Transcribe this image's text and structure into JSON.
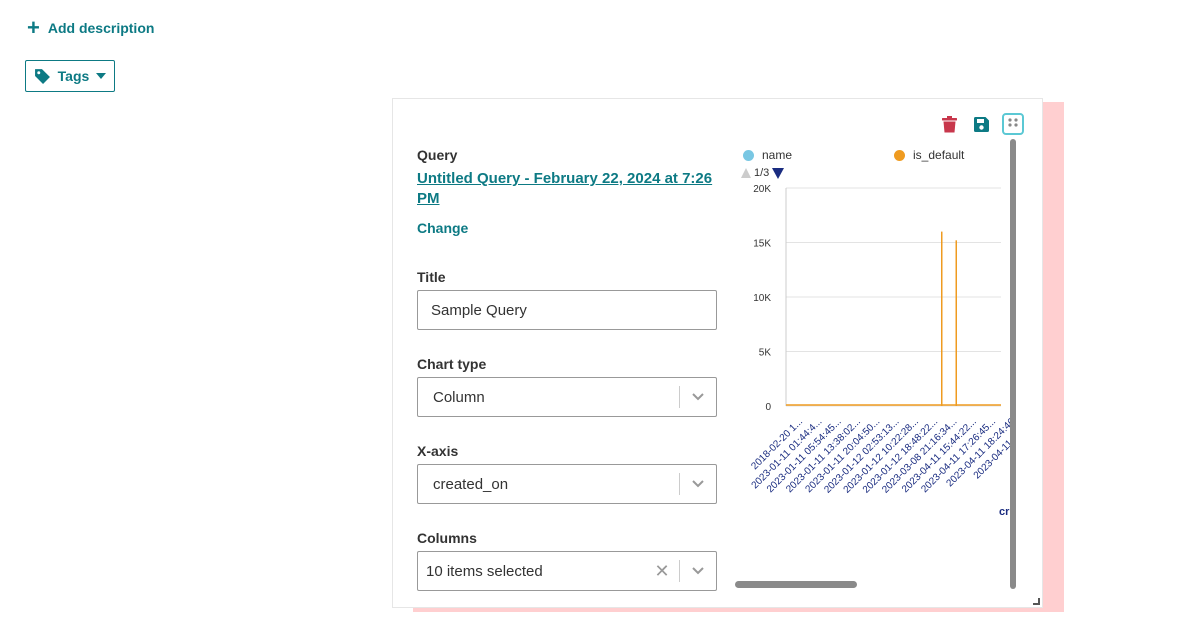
{
  "header": {
    "add_description": "Add description",
    "tags_label": "Tags"
  },
  "card": {
    "query_label": "Query",
    "query_name": "Untitled Query - February 22, 2024 at 7:26 PM",
    "change_label": "Change",
    "title_label": "Title",
    "title_value": "Sample Query",
    "chart_type_label": "Chart type",
    "chart_type_value": "Column",
    "xaxis_label": "X-axis",
    "xaxis_value": "created_on",
    "columns_label": "Columns",
    "columns_value": "10 items selected",
    "colors": {
      "accent": "#0d7a84",
      "delete": "#c8374c",
      "save": "#0d7a84"
    }
  },
  "chart_data": {
    "type": "bar",
    "legend": [
      {
        "name": "name",
        "color": "#79c7e3"
      },
      {
        "name": "is_default",
        "color": "#ef9b20"
      }
    ],
    "legend_page": "1/3",
    "yticks": [
      "20K",
      "15K",
      "10K",
      "5K",
      "0"
    ],
    "ylim": [
      0,
      20000
    ],
    "categories": [
      "2018-02-20 1...",
      "2023-01-11 01:44:4...",
      "2023-01-11 05:54:45...",
      "2023-01-11 13:38:02...",
      "2023-01-11 20:04:50...",
      "2023-01-12 02:53:13...",
      "2023-01-12 10:22:28...",
      "2023-01-12 18:48:22...",
      "2023-03-08 21:16:34...",
      "2023-04-11 15:44:22...",
      "2023-04-11 17:26:45...",
      "2023-04-11 18:24:46",
      "2023-04-11 20:3...",
      "2023-04...",
      "202..."
    ],
    "series": [
      {
        "name": "is_default",
        "color": "#ef9b20",
        "values": [
          0,
          0,
          0,
          0,
          0,
          0,
          0,
          0,
          0,
          0,
          16000,
          15200,
          0,
          0,
          0
        ]
      }
    ],
    "xlabel_partial": "cr"
  }
}
